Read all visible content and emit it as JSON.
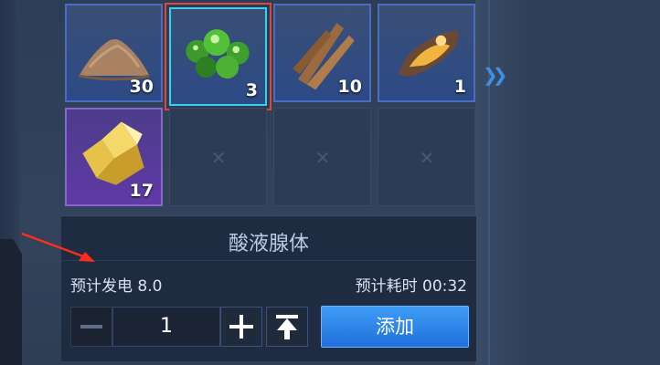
{
  "inventory": {
    "slots": [
      {
        "item": "sand-pile",
        "count": "30",
        "rarity": "blue"
      },
      {
        "item": "acid-gland",
        "count": "3",
        "rarity": "blue",
        "selected": true
      },
      {
        "item": "wood-strips",
        "count": "10",
        "rarity": "blue"
      },
      {
        "item": "amber-resin",
        "count": "1",
        "rarity": "blue"
      },
      {
        "item": "gold-crystal",
        "count": "17",
        "rarity": "purple"
      }
    ],
    "more_icon": "double-chevron-right-icon"
  },
  "panel": {
    "title": "酸液腺体",
    "estimated_power": "预计发电 8.0",
    "estimated_time": "预计耗时 00:32",
    "quantity": "1",
    "add_label": "添加",
    "minus_icon": "minus-icon",
    "plus_icon": "plus-icon",
    "max_icon": "max-arrow-icon"
  },
  "colors": {
    "slot_blue": "#2c4a86",
    "slot_purple": "#5f3aa6",
    "selection": "#e0463c",
    "accent": "#1f6fdc"
  }
}
